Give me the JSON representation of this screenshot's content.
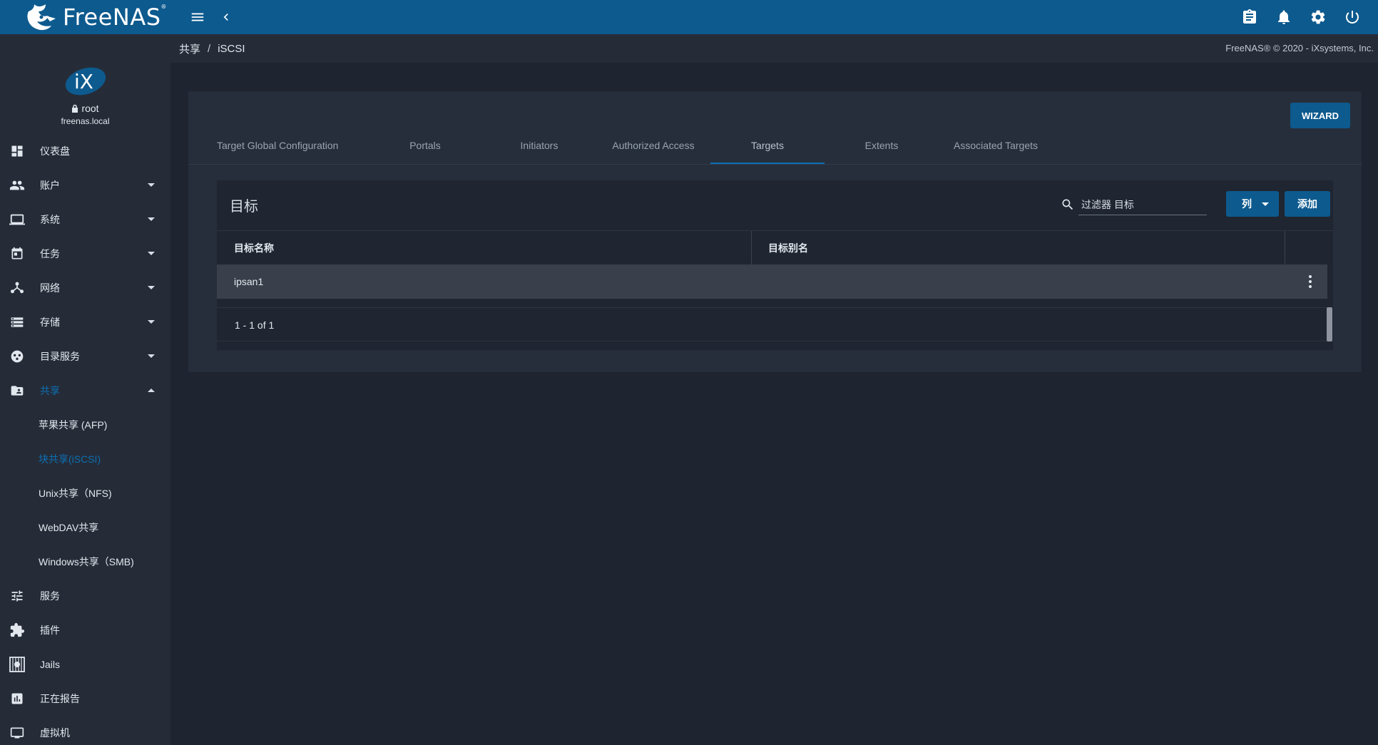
{
  "app": {
    "name": "FreeNAS",
    "trademark": "®"
  },
  "header": {
    "icons": [
      "menu-icon",
      "chevron-left-icon",
      "clipboard-icon",
      "bell-icon",
      "gear-icon",
      "power-icon"
    ]
  },
  "profile": {
    "username": "root",
    "hostname": "freenas.local"
  },
  "sidebar": {
    "items": [
      {
        "label": "仪表盘",
        "icon": "dashboard-icon"
      },
      {
        "label": "账户",
        "icon": "people-icon",
        "expandable": true
      },
      {
        "label": "系统",
        "icon": "laptop-icon",
        "expandable": true
      },
      {
        "label": "任务",
        "icon": "calendar-icon",
        "expandable": true
      },
      {
        "label": "网络",
        "icon": "network-icon",
        "expandable": true
      },
      {
        "label": "存储",
        "icon": "storage-icon",
        "expandable": true
      },
      {
        "label": "目录服务",
        "icon": "directory-icon",
        "expandable": true
      },
      {
        "label": "共享",
        "icon": "folder-shared-icon",
        "expandable": true,
        "expanded": true,
        "active": true
      }
    ],
    "sub_items": [
      {
        "label": "苹果共享 (AFP)"
      },
      {
        "label": "块共享(iSCSI)",
        "active": true
      },
      {
        "label": "Unix共享（NFS)"
      },
      {
        "label": "WebDAV共享"
      },
      {
        "label": "Windows共享（SMB)"
      }
    ],
    "items_after": [
      {
        "label": "服务",
        "icon": "tune-icon"
      },
      {
        "label": "插件",
        "icon": "puzzle-icon"
      },
      {
        "label": "Jails",
        "icon": "jail-icon"
      },
      {
        "label": "正在报告",
        "icon": "report-icon"
      },
      {
        "label": "虚拟机",
        "icon": "monitor-icon"
      }
    ]
  },
  "breadcrumb": {
    "parent": "共享",
    "separator": "/",
    "current": "iSCSI"
  },
  "copyright": "FreeNAS® © 2020 - iXsystems, Inc.",
  "card": {
    "wizard_label": "WIZARD",
    "tabs": [
      {
        "label": "Target Global Configuration"
      },
      {
        "label": "Portals"
      },
      {
        "label": "Initiators"
      },
      {
        "label": "Authorized Access"
      },
      {
        "label": "Targets",
        "active": true
      },
      {
        "label": "Extents"
      },
      {
        "label": "Associated Targets"
      }
    ]
  },
  "table": {
    "title": "目标",
    "filter_placeholder": "过滤器 目标",
    "columns_label": "列",
    "add_label": "添加",
    "headers": [
      "目标名称",
      "目标别名"
    ],
    "rows": [
      {
        "name": "ipsan1",
        "alias": ""
      }
    ],
    "pager": "1 - 1 of 1"
  },
  "colors": {
    "accent": "#0d5a8e",
    "active_link": "#0d6fb3",
    "background": "#1e2430",
    "sidebar": "#252c38"
  }
}
